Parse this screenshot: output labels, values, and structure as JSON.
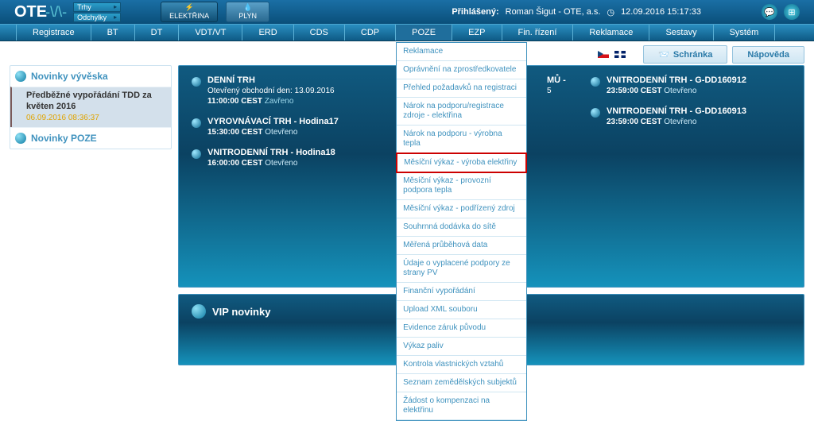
{
  "topbar": {
    "logo_main": "OTE",
    "logo_suffix": "-\\/\\-",
    "trhy": "Trhy",
    "odchylky": "Odchylky",
    "elektrina": "ELEKTŘINA",
    "plyn": "PLYN",
    "logged_label": "Přihlášený:",
    "user": "Roman Šigut - OTE, a.s.",
    "datetime": "12.09.2016 15:17:33"
  },
  "menu": {
    "items": [
      "Registrace",
      "BT",
      "DT",
      "VDT/VT",
      "ERD",
      "CDS",
      "CDP",
      "POZE",
      "EZP",
      "Fin. řízení",
      "Reklamace",
      "Sestavy",
      "Systém"
    ],
    "dropdown": {
      "items": [
        "Reklamace",
        "Oprávnění na zprostředkovatele",
        "Přehled požadavků na registraci",
        "Nárok na podporu/registrace zdroje - elektřina",
        "Nárok na podporu - výrobna tepla",
        "Měsíční výkaz - výroba elektřiny",
        "Měsíční výkaz - provozní podpora tepla",
        "Měsíční výkaz - podřízený zdroj",
        "Souhrnná dodávka do sítě",
        "Měřená průběhová data",
        "Údaje o vyplacené podpory ze strany PV",
        "Finanční vypořádání",
        "Upload XML souboru",
        "Evidence záruk původu",
        "Výkaz paliv",
        "Kontrola vlastnických vztahů",
        "Seznam zemědělských subjektů",
        "Žádost o kompenzaci na elektřinu"
      ],
      "highlight_index": 5
    }
  },
  "util": {
    "schranka": "Schránka",
    "napoveda": "Nápověda"
  },
  "leftnav": {
    "novinky_vyveska": "Novinky vývěska",
    "row_title": "Předběžné vypořádání TDD za květen 2016",
    "row_ts": "06.09.2016 08:36:37",
    "novinky_poze": "Novinky POZE"
  },
  "panel": {
    "col1": [
      {
        "title": "DENNÍ TRH",
        "line2": "Otevřený obchodní den: 13.09.2016",
        "line3": "11:00:00 CEST",
        "state": "Zavřeno",
        "state_class": "closed"
      },
      {
        "title": "VYROVNÁVACÍ TRH - Hodina17",
        "line2": "",
        "line3": "15:30:00 CEST",
        "state": "Otevřeno",
        "state_class": "open"
      },
      {
        "title": "VNITRODENNÍ TRH - Hodina18",
        "line2": "",
        "line3": "16:00:00 CEST",
        "state": "Otevřeno",
        "state_class": "open"
      }
    ],
    "col2_partial": {
      "title_suffix": "MŮ -",
      "line2_suffix": "5"
    },
    "col3": [
      {
        "title": "VNITRODENNÍ TRH - G-DD160912",
        "line3": "23:59:00 CEST",
        "state": "Otevřeno",
        "state_class": "open"
      },
      {
        "title": "VNITRODENNÍ TRH - G-DD160913",
        "line3": "23:59:00 CEST",
        "state": "Otevřeno",
        "state_class": "open"
      }
    ]
  },
  "vip": {
    "title": "VIP novinky"
  }
}
